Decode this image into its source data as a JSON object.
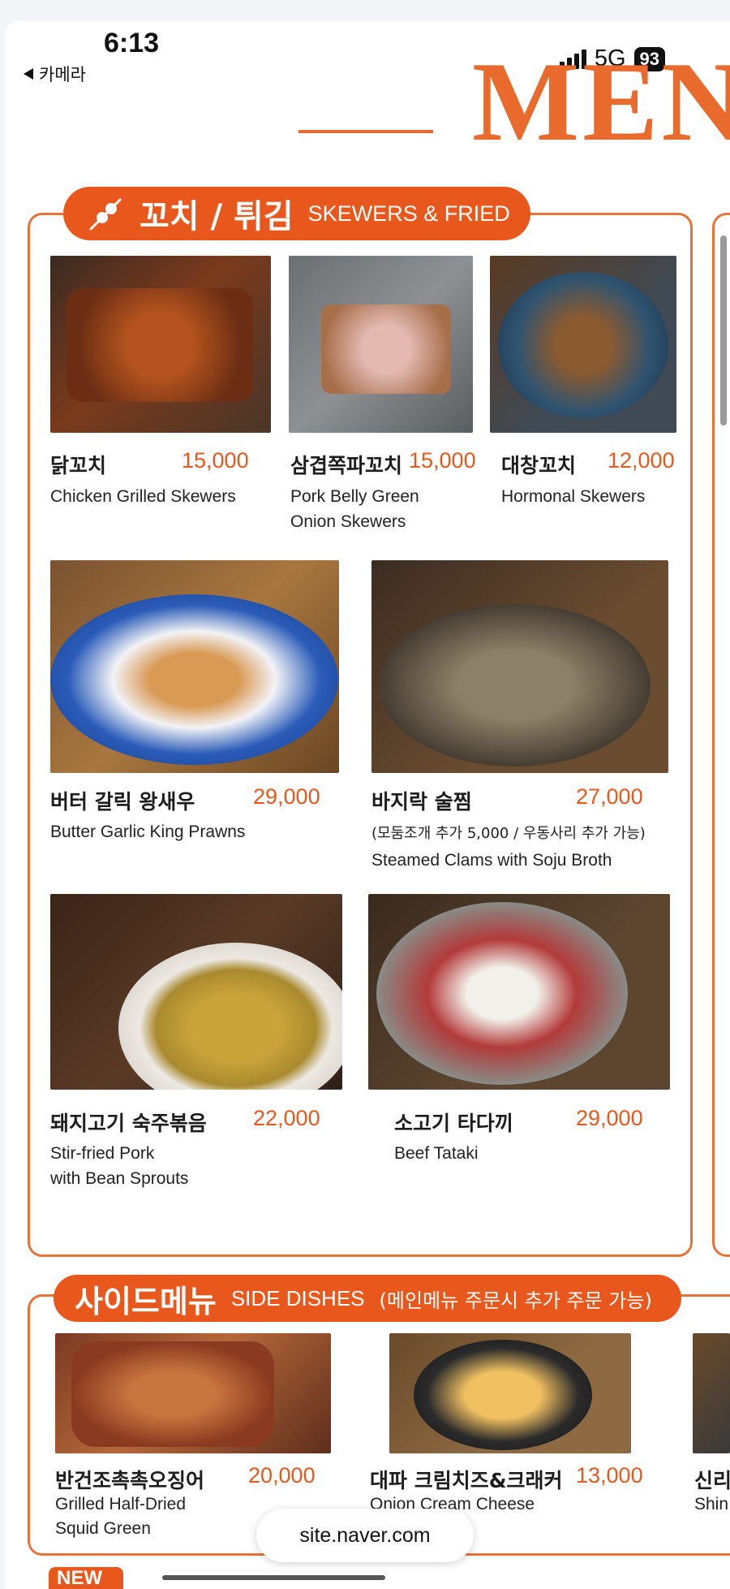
{
  "status_bar": {
    "time": "6:13",
    "back_label": "카메라",
    "network": "5G",
    "battery": "93"
  },
  "title": "MEN",
  "section1": {
    "title_ko": "꼬치 / 튀김",
    "title_en": "SKEWERS & FRIED",
    "items": [
      {
        "ko": "닭꼬치",
        "price": "15,000",
        "en_lines": [
          "Chicken Grilled Skewers"
        ]
      },
      {
        "ko": "삼겹쪽파꼬치",
        "price": "15,000",
        "en_lines": [
          "Pork Belly Green",
          "Onion Skewers"
        ]
      },
      {
        "ko": "대창꼬치",
        "price": "12,000",
        "en_lines": [
          "Hormonal Skewers"
        ]
      },
      {
        "ko": "버터 갈릭 왕새우",
        "price": "29,000",
        "en_lines": [
          "Butter Garlic King Prawns"
        ]
      },
      {
        "ko": "바지락 술찜",
        "price": "27,000",
        "note": "(모둠조개 추가 5,000 / 우동사리 추가 가능)",
        "en_lines": [
          "Steamed Clams with Soju Broth"
        ]
      },
      {
        "ko": "돼지고기 숙주볶음",
        "price": "22,000",
        "en_lines": [
          "Stir-fried Pork",
          "with Bean Sprouts"
        ]
      },
      {
        "ko": "소고기 타다끼",
        "price": "29,000",
        "en_lines": [
          "Beef Tataki"
        ]
      }
    ]
  },
  "section2": {
    "title_ko": "사이드메뉴",
    "title_en": "SIDE DISHES",
    "note": "(메인메뉴 주문시 추가 주문 가능)",
    "items": [
      {
        "ko": "반건조촉촉오징어",
        "price": "20,000",
        "en_lines": [
          "Grilled Half-Dried",
          "Squid Green"
        ]
      },
      {
        "ko": "대파 크림치즈&크래커",
        "price": "13,000",
        "en_lines": [
          "Onion Cream Cheese"
        ]
      },
      {
        "ko": "신리",
        "en_lines": [
          "Shin"
        ]
      }
    ]
  },
  "new_badge": "NEW",
  "url": "site.naver.com",
  "colors": {
    "accent": "#e8581c",
    "border": "#e8733a",
    "title": "#e86a2c"
  },
  "icons": [
    "skewer-icon",
    "back-triangle-icon",
    "signal-icon",
    "battery-icon"
  ]
}
